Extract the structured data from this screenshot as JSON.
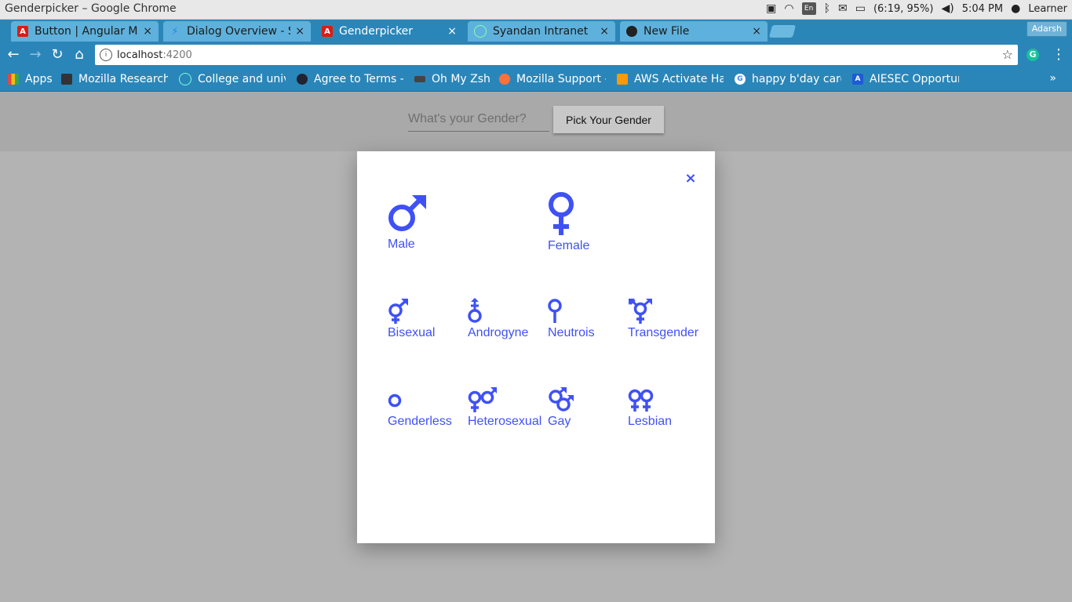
{
  "window": {
    "title": "Genderpicker – Google Chrome",
    "tray": {
      "lang": "En",
      "battery": "(6:19, 95%)",
      "time": "5:04 PM",
      "user": "Learner"
    }
  },
  "tabs": [
    {
      "label": "Button | Angular Ma",
      "icon": "angular-icon",
      "color": "#dd1b16"
    },
    {
      "label": "Dialog Overview - S",
      "icon": "bolt-icon",
      "color": "#1e88e5"
    },
    {
      "label": "Genderpicker",
      "icon": "angular-icon",
      "color": "#dd1b16",
      "active": true
    },
    {
      "label": "Syandan Intranet",
      "icon": "globe-icon",
      "color": "#9aa"
    },
    {
      "label": "New File",
      "icon": "github-icon",
      "color": "#222"
    }
  ],
  "profile": "Adarsh",
  "address": {
    "host": "localhost",
    "port": ":4200"
  },
  "bookmarks": [
    {
      "label": "Apps",
      "color": "#e8453c"
    },
    {
      "label": "Mozilla Research",
      "color": "#333"
    },
    {
      "label": "College and univ",
      "color": "#4caf50"
    },
    {
      "label": "Agree to Terms -",
      "color": "#333"
    },
    {
      "label": "Oh My Zsh",
      "color": "#444"
    },
    {
      "label": "Mozilla Support -",
      "color": "#ff7139"
    },
    {
      "label": "AWS Activate Ha",
      "color": "#f90"
    },
    {
      "label": "happy b'day card",
      "color": "#4285f4"
    },
    {
      "label": "AIESEC Opportur",
      "color": "#1e5bd6"
    }
  ],
  "bookmarks_more": "»",
  "form": {
    "placeholder": "What's your Gender?",
    "button": "Pick Your Gender"
  },
  "dialog": {
    "close": "×",
    "accent": "#3f51f5",
    "options": [
      {
        "label": "Male",
        "icon": "male-icon"
      },
      {
        "label": "Female",
        "icon": "female-icon"
      },
      {
        "label": "Bisexual",
        "icon": "bisexual-icon"
      },
      {
        "label": "Androgyne",
        "icon": "androgyne-icon"
      },
      {
        "label": "Neutrois",
        "icon": "neutrois-icon"
      },
      {
        "label": "Transgender",
        "icon": "transgender-icon"
      },
      {
        "label": "Genderless",
        "icon": "genderless-icon"
      },
      {
        "label": "Heterosexual",
        "icon": "heterosexual-icon"
      },
      {
        "label": "Gay",
        "icon": "gay-icon"
      },
      {
        "label": "Lesbian",
        "icon": "lesbian-icon"
      }
    ]
  }
}
